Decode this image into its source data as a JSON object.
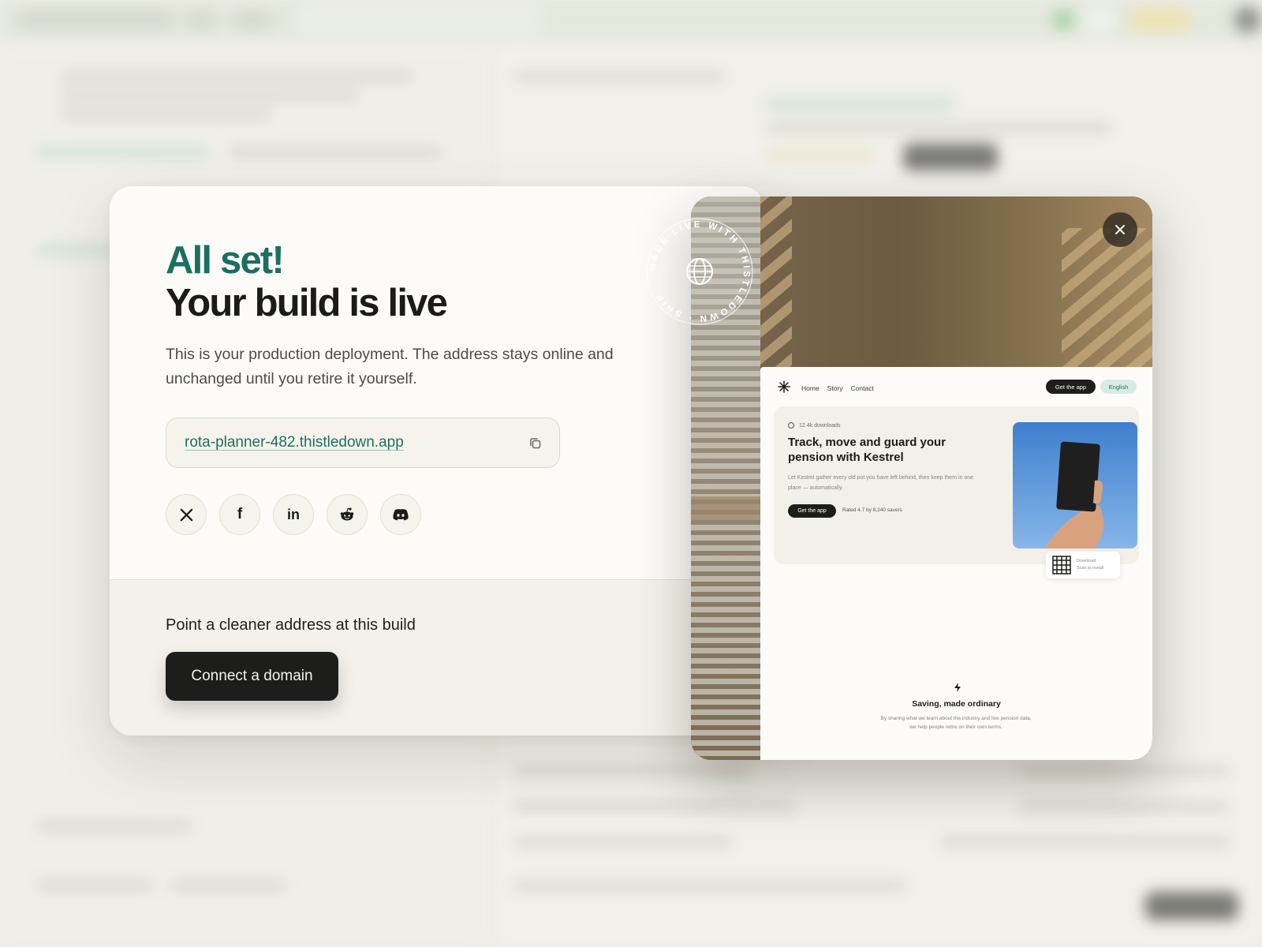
{
  "dialog": {
    "title_accent": "All set!",
    "title_main": "Your build is live",
    "description": "This is your production deployment. The address stays online and unchanged until you retire it yourself.",
    "url": "rota-planner-482.thistledown.app",
    "copy_icon": "copy-icon",
    "share_buttons": [
      {
        "name": "x",
        "icon": "x-logo-icon"
      },
      {
        "name": "facebook",
        "icon": "facebook-icon",
        "glyph": "f"
      },
      {
        "name": "linkedin",
        "icon": "linkedin-icon",
        "glyph": "in"
      },
      {
        "name": "reddit",
        "icon": "reddit-icon"
      },
      {
        "name": "discord",
        "icon": "discord-icon"
      }
    ],
    "domain_prompt": "Point a cleaner address at this build",
    "connect_button": "Connect a domain"
  },
  "seal": {
    "text": "MADE LIVE WITH THISTLEDOWN · SHIP ",
    "icon": "globe-icon"
  },
  "preview": {
    "close_icon": "close-icon",
    "site": {
      "logo_icon": "asterisk-icon",
      "nav": [
        "Home",
        "Story",
        "Contact"
      ],
      "nav_cta": "Get the app",
      "language": "English",
      "downloads": "12.4k downloads",
      "hero_title": "Track, move and guard your pension with Kestrel",
      "hero_subtitle": "Let Kestrel gather every old pot you have left behind, then keep them in one place — automatically.",
      "hero_button": "Get the app",
      "rating": "Rated 4.7 by 8,240 savers",
      "qr_label": "Download",
      "qr_sublabel": "Scan to install",
      "section_icon": "bolt-icon",
      "section_title": "Saving, made ordinary",
      "section_body": "By sharing what we learn about the industry and live pension data, we help people retire on their own terms."
    }
  },
  "colors": {
    "accent": "#1b6f61",
    "ink": "#1b1b19",
    "surface": "#fcfbf8",
    "surface_alt": "#f3f1ea"
  }
}
